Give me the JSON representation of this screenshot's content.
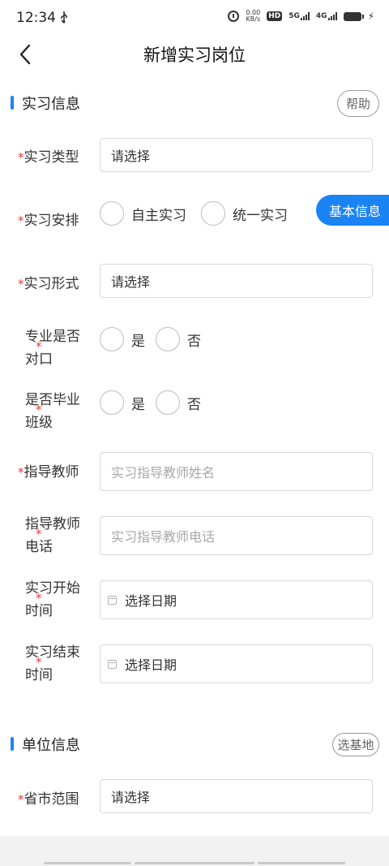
{
  "status_bar": {
    "time": "12:34",
    "usb_icon": "usb-icon",
    "net_speed_top": "0.00",
    "net_speed_bottom": "KB/s",
    "hd": "HD",
    "sig1": "5G",
    "sig2": "4G",
    "bolt": "⚡"
  },
  "nav": {
    "title": "新增实习岗位"
  },
  "internship_section": {
    "title": "实习信息",
    "help_label": "帮助"
  },
  "fields": {
    "type": {
      "label": "实习类型",
      "value": "请选择"
    },
    "arrangement": {
      "label": "实习安排",
      "options": [
        "自主实习",
        "统一实习"
      ]
    },
    "form": {
      "label": "实习形式",
      "value": "请选择"
    },
    "major_match": {
      "label_line1": "专业是否",
      "label_line2": "对口",
      "options": [
        "是",
        "否"
      ]
    },
    "graduating": {
      "label_line1": "是否毕业",
      "label_line2": "班级",
      "options": [
        "是",
        "否"
      ]
    },
    "teacher": {
      "label": "指导教师",
      "placeholder": "实习指导教师姓名"
    },
    "teacher_phone": {
      "label_line1": "指导教师",
      "label_line2": "电话",
      "placeholder": "实习指导教师电话"
    },
    "start_time": {
      "label_line1": "实习开始",
      "label_line2": "时间",
      "value": "选择日期"
    },
    "end_time": {
      "label_line1": "实习结束",
      "label_line2": "时间",
      "value": "选择日期"
    }
  },
  "float_tag": {
    "label": "基本信息"
  },
  "unit_section": {
    "title": "单位信息",
    "select_base_label": "选基地"
  },
  "unit_fields": {
    "region": {
      "label": "省市范围",
      "value": "请选择"
    }
  },
  "required_mark": "*",
  "colors": {
    "accent": "#1a84f5",
    "required": "#e63a3a"
  }
}
